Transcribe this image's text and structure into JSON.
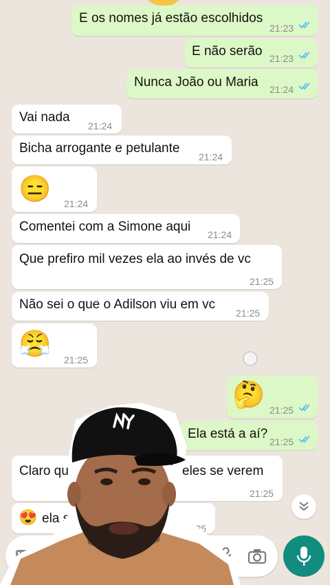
{
  "messages": {
    "m1": {
      "text": "E os nomes já estão escolhidos",
      "time": "21:23"
    },
    "m2": {
      "text": "E não serão",
      "time": "21:23"
    },
    "m3": {
      "text": "Nunca João ou Maria",
      "time": "21:24"
    },
    "m4": {
      "text": "Vai nada",
      "time": "21:24"
    },
    "m5": {
      "text": "Bicha arrogante e petulante",
      "time": "21:24"
    },
    "m6": {
      "emoji": "😑",
      "time": "21:24"
    },
    "m7": {
      "text": "Comentei com a Simone aqui",
      "time": "21:24"
    },
    "m8": {
      "text": "Que prefiro mil vezes ela ao invés de vc",
      "time": "21:25"
    },
    "m9": {
      "text": "Não sei o que o Adilson viu em vc",
      "time": "21:25"
    },
    "m10": {
      "emoji": "😤",
      "time": "21:25"
    },
    "m11": {
      "emoji": "🤔",
      "time": "21:25"
    },
    "m12": {
      "text": "Ela está a aí?",
      "time": "21:25"
    },
    "m13": {
      "text_left": "Claro qu",
      "text_right": "eles se verem",
      "time": "21:25"
    },
    "m14": {
      "emoji": "😍",
      "text": "ela se",
      "time": "21:25"
    }
  },
  "colors": {
    "background": "#ece5dd",
    "incoming": "#ffffff",
    "outgoing": "#dcf8c6",
    "read_ticks": "#4fc3f7",
    "mic_button": "#128c7e"
  },
  "icons": {
    "keyboard": "keyboard-icon",
    "attach": "paperclip-icon",
    "camera": "camera-icon",
    "mic": "microphone-icon",
    "scroll": "double-chevron-down-icon",
    "cap_logo": "ny-logo-icon"
  }
}
